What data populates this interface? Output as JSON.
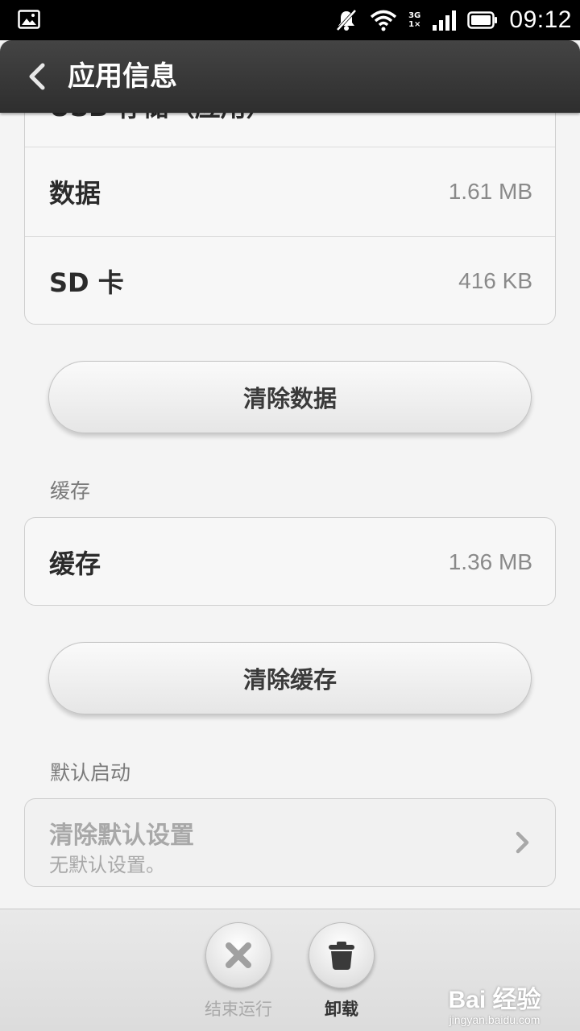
{
  "status_bar": {
    "time": "09:12",
    "network_top": "3G",
    "network_bottom": "1×",
    "icons": [
      "image-icon",
      "mute-icon",
      "wifi-icon",
      "signal-icon",
      "battery-icon"
    ]
  },
  "header": {
    "title": "应用信息",
    "back_icon": "chevron-left-icon"
  },
  "storage": {
    "partial_row_label": "USB 存储（应用）",
    "rows": [
      {
        "label": "数据",
        "value": "1.61 MB"
      },
      {
        "label": "SD 卡",
        "value": "416 KB"
      }
    ],
    "clear_data_label": "清除数据"
  },
  "cache": {
    "section_title": "缓存",
    "row": {
      "label": "缓存",
      "value": "1.36 MB"
    },
    "clear_cache_label": "清除缓存"
  },
  "default_launch": {
    "section_title": "默认启动",
    "item_title": "清除默认设置",
    "item_subtitle": "无默认设置。",
    "chevron_icon": "chevron-right-icon"
  },
  "bottom_actions": [
    {
      "label": "结束运行",
      "icon": "close-x-icon",
      "enabled": false
    },
    {
      "label": "卸载",
      "icon": "trash-icon",
      "enabled": true
    }
  ],
  "watermark": {
    "brand": "Bai 经验",
    "url": "jingyan.baidu.com"
  },
  "colors": {
    "title_bar": "#333333",
    "background": "#f4f4f4",
    "disabled_text": "#a9a9a9"
  }
}
